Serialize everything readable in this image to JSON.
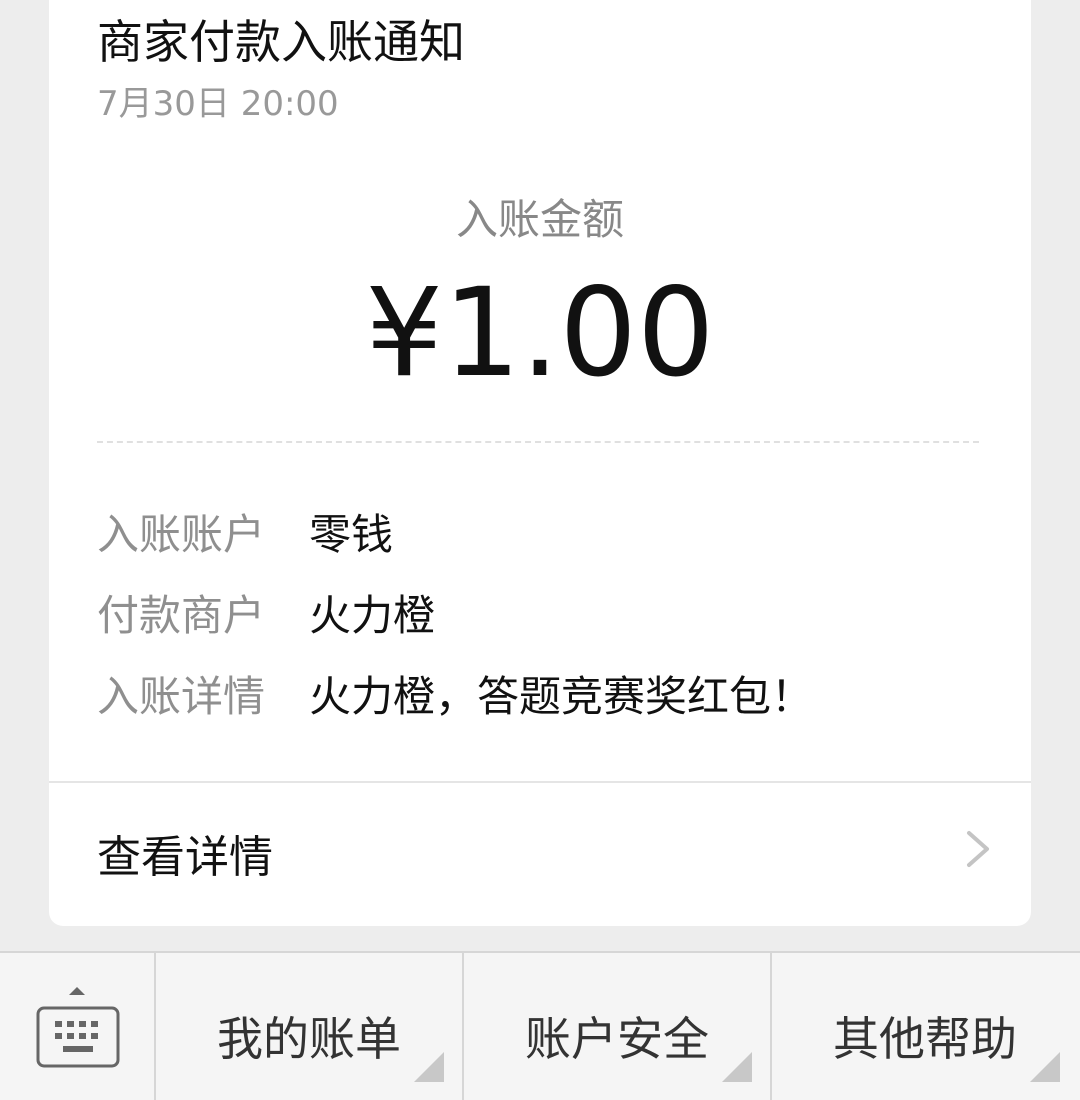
{
  "notification": {
    "title": "商家付款入账通知",
    "time": "7月30日  20:00",
    "amount_label": "入账金额",
    "amount": "¥1.00",
    "rows": [
      {
        "key": "入账账户",
        "value": "零钱"
      },
      {
        "key": "付款商户",
        "value": "火力橙"
      },
      {
        "key": "入账详情",
        "value": "火力橙，答题竞赛奖红包！"
      }
    ],
    "view_details": "查看详情"
  },
  "bottom_menu": {
    "keyboard_icon": "keyboard-icon",
    "items": [
      {
        "label": "我的账单"
      },
      {
        "label": "账户安全"
      },
      {
        "label": "其他帮助"
      }
    ]
  }
}
